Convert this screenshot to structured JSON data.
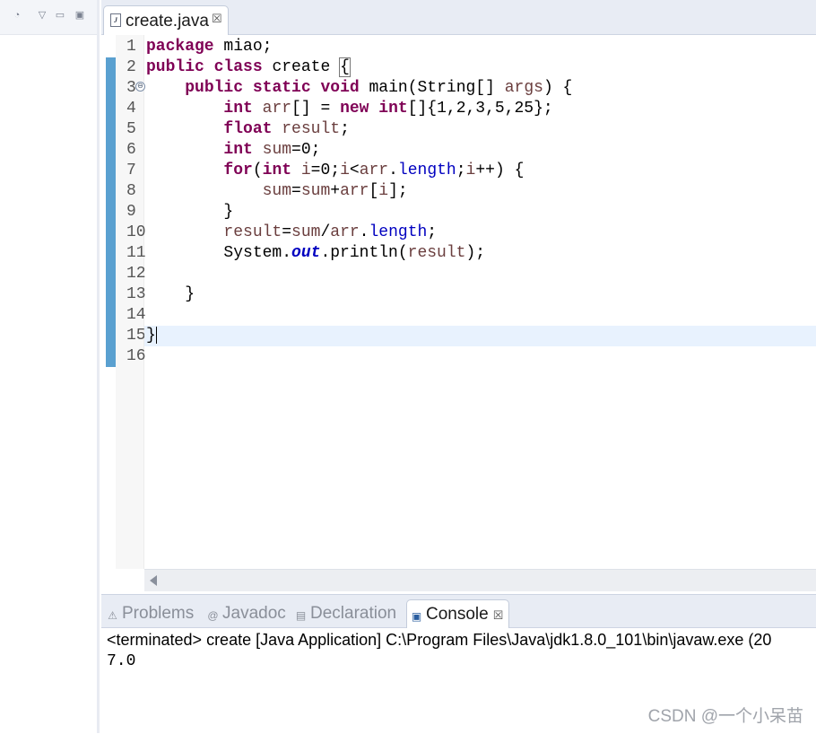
{
  "editor_tab": {
    "label": "create.java",
    "close": "☒"
  },
  "left_panel": {
    "icons": [
      "◔",
      "▽",
      "▭",
      "▣"
    ]
  },
  "line_numbers": [
    "1",
    "2",
    "3",
    "4",
    "5",
    "6",
    "7",
    "8",
    "9",
    "10",
    "11",
    "12",
    "13",
    "14",
    "15",
    "16"
  ],
  "fold_marker": "⊖",
  "code_lines": [
    "package miao;",
    "public class create {",
    "    public static void main(String[] args) {",
    "        int arr[] = new int[]{1,2,3,5,25};",
    "        float result;",
    "        int sum=0;",
    "        for(int i=0;i<arr.length;i++) {",
    "            sum=sum+arr[i];",
    "        }",
    "        result=sum/arr.length;",
    "        System.out.println(result);",
    "",
    "    }",
    "",
    "}",
    ""
  ],
  "bottom_tabs": [
    {
      "label": "Problems",
      "icon": "⚠"
    },
    {
      "label": "Javadoc",
      "icon": "@"
    },
    {
      "label": "Declaration",
      "icon": "▤"
    },
    {
      "label": "Console",
      "icon": "▣",
      "close": "☒"
    }
  ],
  "console": {
    "header": "<terminated> create [Java Application] C:\\Program Files\\Java\\jdk1.8.0_101\\bin\\javaw.exe (20",
    "output": "7.0"
  },
  "watermark": "CSDN @一个小呆苗",
  "colors": {
    "keyword": "#7f0055",
    "field": "#0000c0",
    "variable": "#6a3e3e",
    "current_line": "#e8f2fe"
  }
}
